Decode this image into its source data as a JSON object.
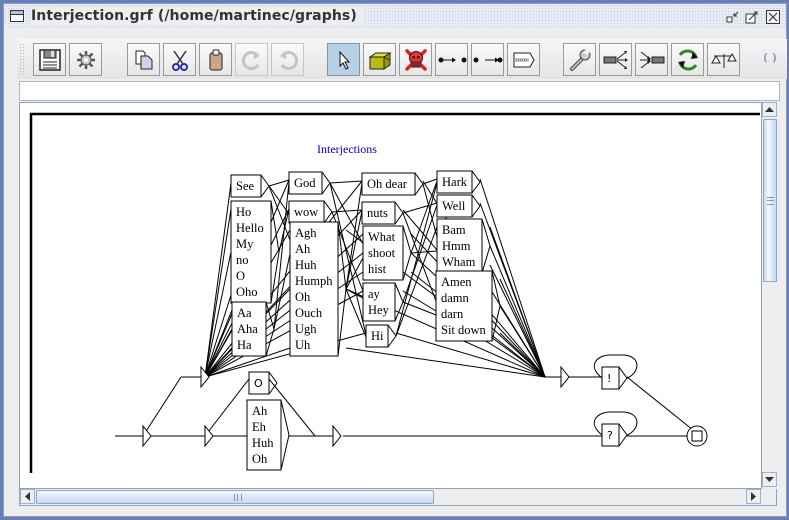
{
  "window": {
    "title": "Interjection.grf (/home/martinec/graphs)",
    "controls": [
      "minimize",
      "maximize",
      "close"
    ]
  },
  "toolbar": {
    "buttons": [
      {
        "id": "save",
        "icon": "floppy-disk-icon",
        "state": "normal"
      },
      {
        "id": "compile",
        "icon": "gear-icon",
        "state": "normal"
      },
      {
        "id": "copy",
        "icon": "copy-icon",
        "state": "normal"
      },
      {
        "id": "cut",
        "icon": "scissors-icon",
        "state": "normal"
      },
      {
        "id": "paste",
        "icon": "clipboard-icon",
        "state": "normal"
      },
      {
        "id": "redo",
        "icon": "redo-icon",
        "state": "disabled"
      },
      {
        "id": "undo",
        "icon": "undo-icon",
        "state": "disabled"
      },
      {
        "id": "select",
        "icon": "arrow-cursor-icon",
        "state": "selected"
      },
      {
        "id": "create-box",
        "icon": "box-icon",
        "state": "normal"
      },
      {
        "id": "delete",
        "icon": "skull-icon",
        "state": "normal"
      },
      {
        "id": "link-from",
        "icon": "link-from-icon",
        "state": "normal"
      },
      {
        "id": "link-to",
        "icon": "link-to-icon",
        "state": "normal"
      },
      {
        "id": "open-subgraph",
        "icon": "subgraph-box-icon",
        "state": "normal"
      },
      {
        "id": "configure",
        "icon": "wrench-icon",
        "state": "normal"
      },
      {
        "id": "explode",
        "icon": "split-out-icon",
        "state": "normal"
      },
      {
        "id": "implode",
        "icon": "merge-in-icon",
        "state": "normal"
      },
      {
        "id": "refresh",
        "icon": "refresh-icon",
        "state": "normal"
      },
      {
        "id": "compare",
        "icon": "balance-scale-icon",
        "state": "normal"
      }
    ],
    "extra_label": "( )"
  },
  "box_text_field": {
    "value": ""
  },
  "graph": {
    "comment": "Interjections",
    "boxes": [
      {
        "id": "see",
        "lines": [
          "See"
        ]
      },
      {
        "id": "ho-list",
        "lines": [
          "Ho",
          "Hello",
          "My",
          "no",
          "O",
          "Oho"
        ]
      },
      {
        "id": "aa-list",
        "lines": [
          "Aa",
          "Aha",
          "Ha"
        ]
      },
      {
        "id": "god",
        "lines": [
          "God"
        ]
      },
      {
        "id": "wow",
        "lines": [
          "wow"
        ]
      },
      {
        "id": "agh-list",
        "lines": [
          "Agh",
          "Ah",
          "Huh",
          "Humph",
          "Oh",
          "Ouch",
          "Ugh",
          "Uh"
        ]
      },
      {
        "id": "oh-dear",
        "lines": [
          "Oh dear"
        ]
      },
      {
        "id": "nuts",
        "lines": [
          "nuts"
        ]
      },
      {
        "id": "what-list",
        "lines": [
          "What",
          "shoot",
          "hist"
        ]
      },
      {
        "id": "ay-list",
        "lines": [
          "ay",
          "Hey"
        ]
      },
      {
        "id": "hi",
        "lines": [
          "Hi"
        ]
      },
      {
        "id": "hark",
        "lines": [
          "Hark"
        ]
      },
      {
        "id": "well",
        "lines": [
          "Well"
        ]
      },
      {
        "id": "bam-list",
        "lines": [
          "Bam",
          "Hmm",
          "Wham"
        ]
      },
      {
        "id": "amen-list",
        "lines": [
          "Amen",
          "damn",
          "darn",
          "Sit down"
        ]
      },
      {
        "id": "o-box",
        "lines": [
          "O"
        ]
      },
      {
        "id": "ah-eh-list",
        "lines": [
          "Ah",
          "Eh",
          "Huh",
          "Oh"
        ]
      },
      {
        "id": "exclaim",
        "lines": [
          "!"
        ]
      },
      {
        "id": "question",
        "lines": [
          "?"
        ]
      }
    ]
  },
  "scrollbars": {
    "vertical": {
      "position": 0.0,
      "visible_fraction": 0.45
    },
    "horizontal": {
      "position": 0.0,
      "visible_fraction": 0.55
    }
  }
}
